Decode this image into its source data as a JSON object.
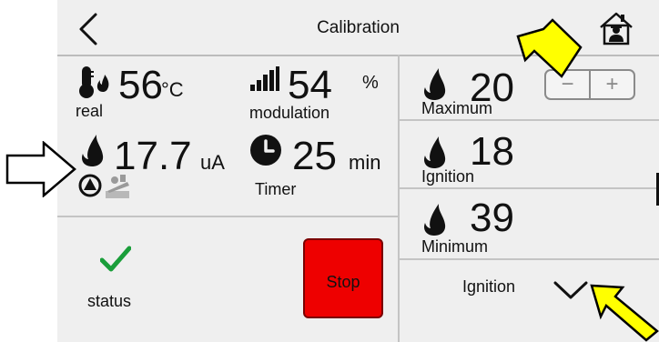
{
  "header": {
    "title": "Calibration",
    "back_icon": "chevron-left-icon",
    "home_icon": "home-user-icon"
  },
  "temperature": {
    "value": "56",
    "unit": "°C",
    "label": "real",
    "icon": "thermometer-flame-icon"
  },
  "modulation": {
    "value": "54",
    "unit": "%",
    "label": "modulation",
    "icon": "signal-bars-icon"
  },
  "flame_current": {
    "value": "17.7",
    "unit": "uA",
    "icons": [
      "flame-icon",
      "pump-icon",
      "chimney-sweep-icon"
    ]
  },
  "timer": {
    "value": "25",
    "unit": "min",
    "label": "Timer",
    "icon": "clock-icon"
  },
  "status": {
    "label": "status",
    "icon": "checkmark-icon",
    "icon_color": "#1a9e3a"
  },
  "stop_button": {
    "label": "Stop",
    "color": "#ee0000"
  },
  "power_levels": [
    {
      "value": "20",
      "label": "Maximum"
    },
    {
      "value": "18",
      "label": "Ignition"
    },
    {
      "value": "39",
      "label": "Minimum"
    }
  ],
  "stepper": {
    "minus": "−",
    "plus": "+"
  },
  "mode_select": {
    "selected": "Ignition",
    "icon": "chevron-down-icon"
  },
  "annotations": {
    "arrow_outline_color": "#000000",
    "arrow_highlight_color": "#ffff00"
  }
}
